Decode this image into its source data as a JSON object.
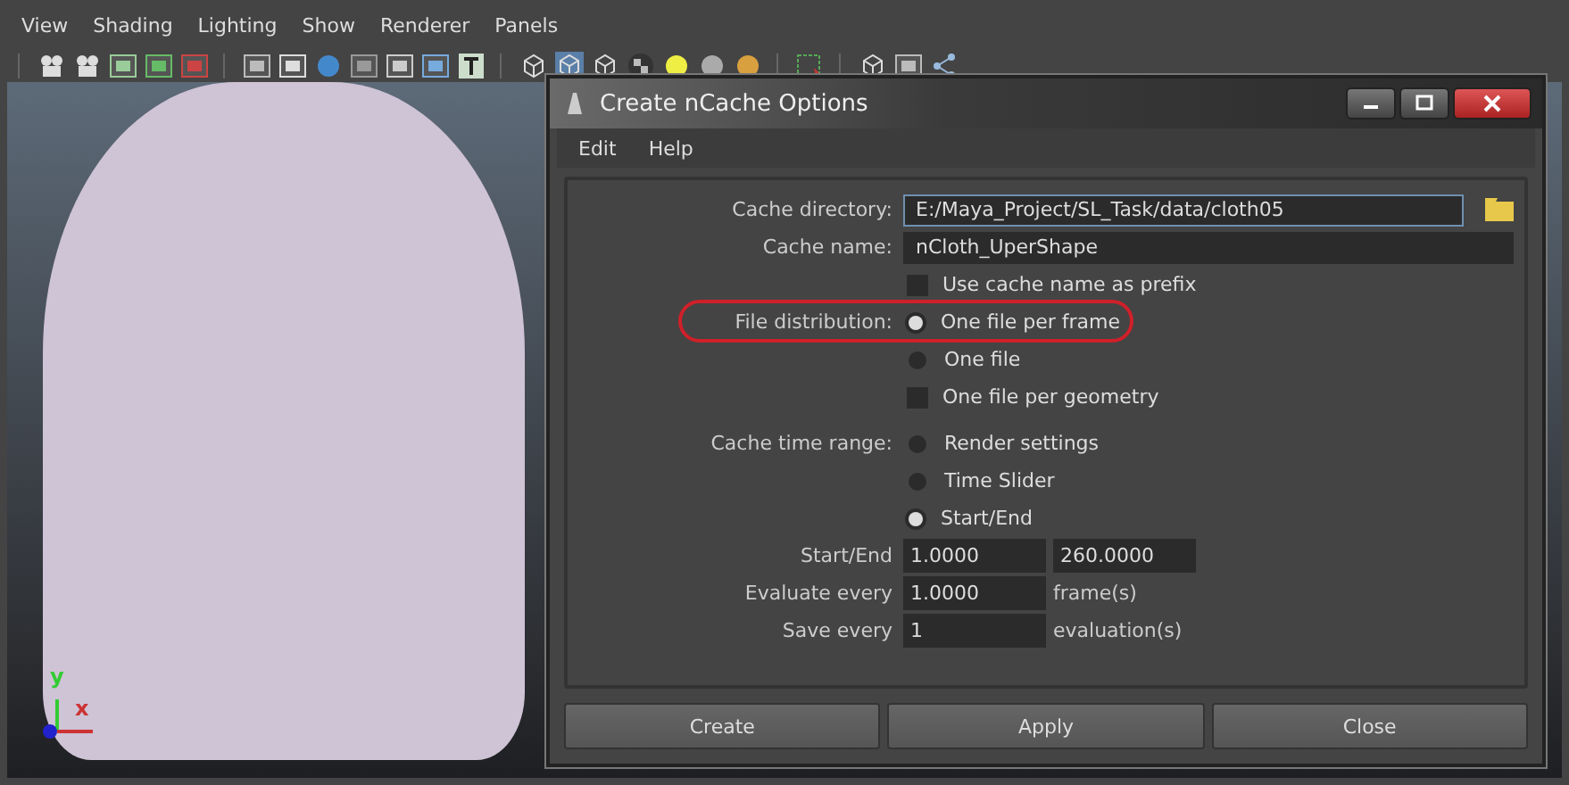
{
  "menu_bar": [
    "View",
    "Shading",
    "Lighting",
    "Show",
    "Renderer",
    "Panels"
  ],
  "axis_labels": {
    "y": "y",
    "x": "x"
  },
  "dialog": {
    "title": "Create nCache Options",
    "menus": [
      "Edit",
      "Help"
    ],
    "fields": [
      {
        "label": "Cache directory:",
        "value": "E:/Maya_Project/SL_Task/data/cloth05",
        "focused": true,
        "browse": true
      },
      {
        "label": "Cache name:",
        "value": "nCloth_UperShape",
        "focused": false,
        "browse": false
      }
    ],
    "prefix_option": {
      "label": "Use cache name as prefix",
      "checked": false
    },
    "file_distribution": {
      "label": "File distribution:",
      "highlighted": true,
      "options": [
        {
          "kind": "radio",
          "label": "One file per frame",
          "selected": true
        },
        {
          "kind": "radio",
          "label": "One file",
          "selected": false
        },
        {
          "kind": "checkbox",
          "label": "One file per geometry",
          "selected": false
        }
      ]
    },
    "cache_time_range": {
      "label": "Cache time range:",
      "options": [
        {
          "kind": "radio",
          "label": "Render settings",
          "selected": false
        },
        {
          "kind": "radio",
          "label": "Time Slider",
          "selected": false
        },
        {
          "kind": "radio",
          "label": "Start/End",
          "selected": true
        }
      ]
    },
    "numeric_rows": [
      {
        "label": "Start/End",
        "values": [
          "1.0000",
          "260.0000"
        ],
        "unit": ""
      },
      {
        "label": "Evaluate every",
        "values": [
          "1.0000"
        ],
        "unit": "frame(s)"
      },
      {
        "label": "Save every",
        "values": [
          "1"
        ],
        "unit": "evaluation(s)"
      }
    ],
    "buttons": [
      "Create",
      "Apply",
      "Close"
    ]
  }
}
